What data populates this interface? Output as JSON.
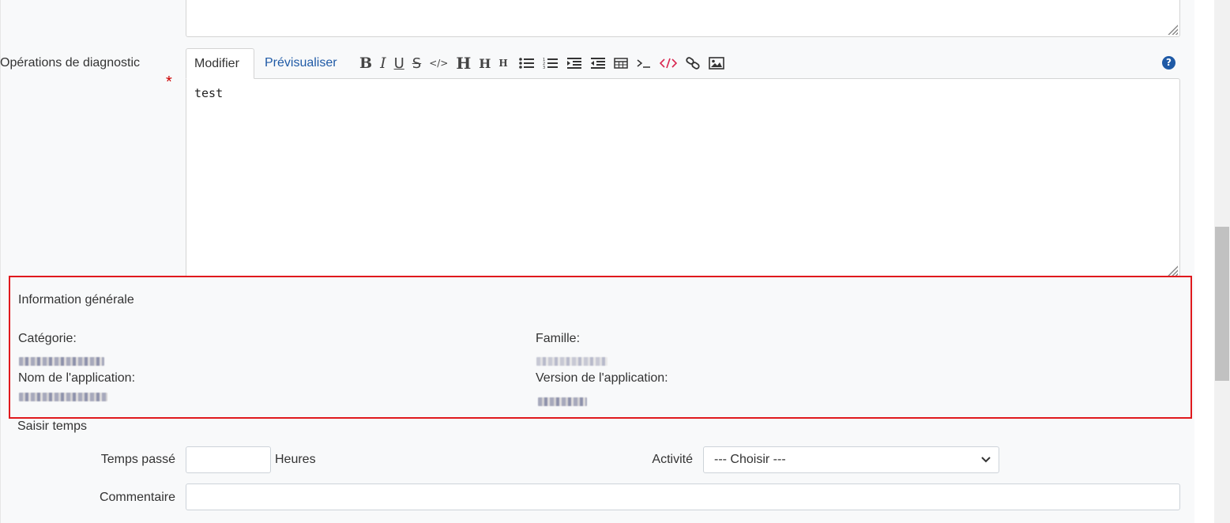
{
  "form": {
    "diagnostic": {
      "label": "Opérations de diagnostic",
      "required_mark": "*",
      "tabs": {
        "edit": "Modifier",
        "preview": "Prévisualiser"
      },
      "toolbar": {
        "bold": "B",
        "italic": "I",
        "underline": "U",
        "strike": "S",
        "code": "</>",
        "h1": "H",
        "h2": "H",
        "h3": "H"
      },
      "help": "?",
      "value": "test"
    },
    "general_info": {
      "title": "Information générale",
      "category_label": "Catégorie:",
      "family_label": "Famille:",
      "app_name_label": "Nom de l'application:",
      "app_version_label": "Version de l'application:"
    },
    "time_entry": {
      "title": "Saisir temps",
      "time_spent_label": "Temps passé",
      "time_spent_value": "",
      "hours_unit": "Heures",
      "activity_label": "Activité",
      "activity_selected": "--- Choisir ---",
      "comment_label": "Commentaire",
      "comment_value": ""
    }
  },
  "colors": {
    "link_blue": "#1f5aa6",
    "required_red": "#cc0000",
    "highlight_red": "#e0191d",
    "code_red": "#d9264f"
  }
}
